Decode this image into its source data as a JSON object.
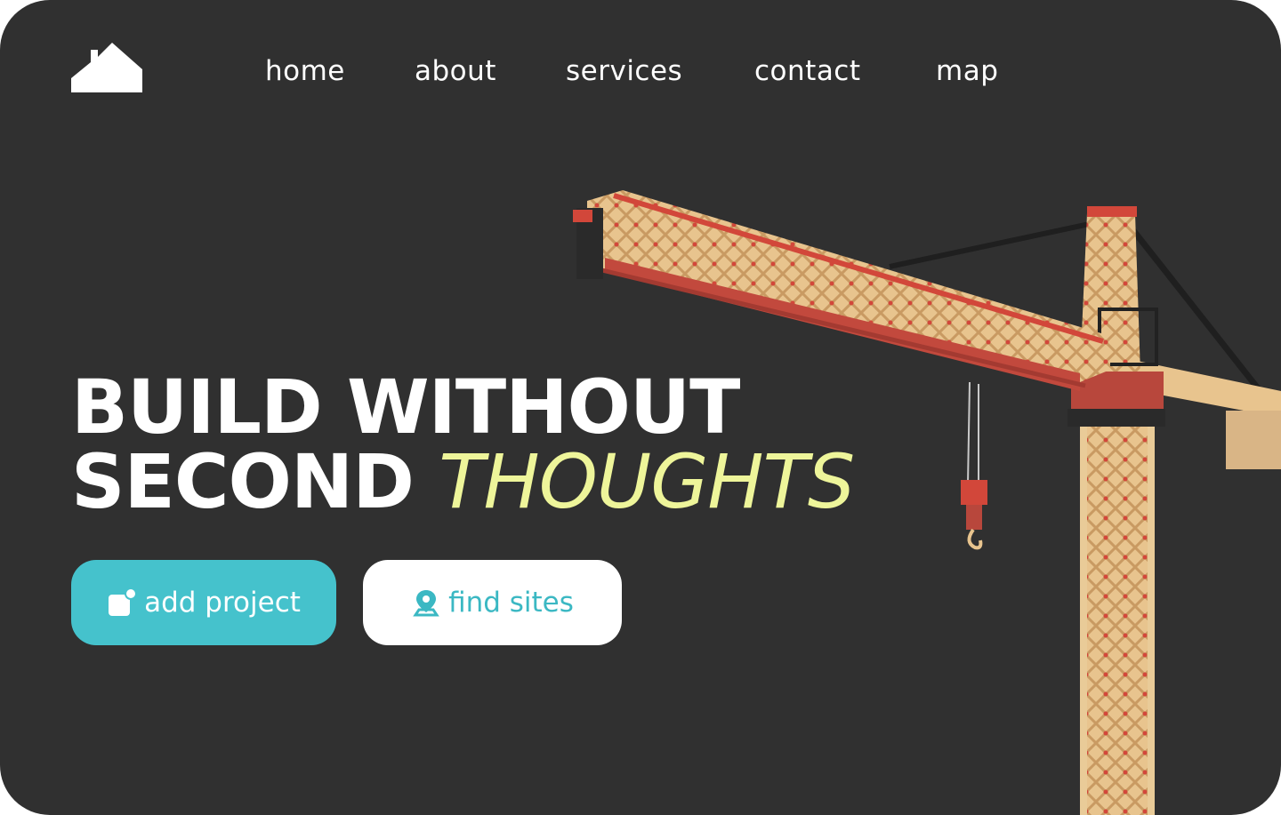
{
  "brand": {
    "logo_icon": "house-icon"
  },
  "nav": {
    "items": [
      {
        "label": "home"
      },
      {
        "label": "about"
      },
      {
        "label": "services"
      },
      {
        "label": "contact"
      },
      {
        "label": "map"
      }
    ]
  },
  "hero": {
    "line1": "BUILD WITHOUT",
    "line2_main": "SECOND",
    "line2_accent": "THOUGHTS",
    "image_icon": "tower-crane-image"
  },
  "actions": {
    "primary_label": "add project",
    "primary_icon": "add-note-icon",
    "secondary_label": "find sites",
    "secondary_icon": "location-pin-icon"
  },
  "colors": {
    "background": "#303030",
    "accent_text": "#eef59a",
    "primary_button": "#45c2cc",
    "secondary_button_text": "#3bb8c3"
  }
}
